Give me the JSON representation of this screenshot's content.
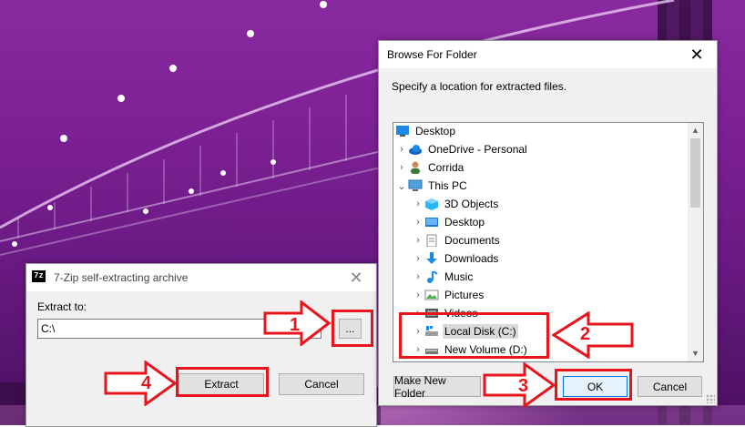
{
  "sfx_dialog": {
    "title": "7-Zip self-extracting archive",
    "app_icon_text": "7z",
    "close_glyph": "✕",
    "extract_to_label": "Extract to:",
    "extract_path_value": "C:\\",
    "browse_label": "...",
    "extract_label": "Extract",
    "cancel_label": "Cancel"
  },
  "browse_dialog": {
    "title": "Browse For Folder",
    "close_glyph": "✕",
    "instruction": "Specify a location for extracted files.",
    "tree": [
      {
        "label": "Desktop",
        "icon": "desktop-folder-icon",
        "chevron": ""
      },
      {
        "label": "OneDrive - Personal",
        "icon": "onedrive-cloud-icon",
        "chevron": "›"
      },
      {
        "label": "Corrida",
        "icon": "user-icon",
        "chevron": "›"
      },
      {
        "label": "This PC",
        "icon": "computer-icon",
        "chevron": "⌄"
      },
      {
        "label": "3D Objects",
        "icon": "3d-objects-icon",
        "chevron": "›"
      },
      {
        "label": "Desktop",
        "icon": "desktop-icon",
        "chevron": "›"
      },
      {
        "label": "Documents",
        "icon": "documents-icon",
        "chevron": "›"
      },
      {
        "label": "Downloads",
        "icon": "downloads-icon",
        "chevron": "›"
      },
      {
        "label": "Music",
        "icon": "music-icon",
        "chevron": "›"
      },
      {
        "label": "Pictures",
        "icon": "pictures-icon",
        "chevron": "›"
      },
      {
        "label": "Videos",
        "icon": "videos-icon",
        "chevron": "›"
      },
      {
        "label": "Local Disk (C:)",
        "icon": "local-disk-icon",
        "chevron": "›"
      },
      {
        "label": "New Volume (D:)",
        "icon": "drive-icon",
        "chevron": "›"
      }
    ],
    "new_folder_label": "Make New Folder",
    "ok_label": "OK",
    "cancel_label": "Cancel",
    "scroll_up_glyph": "▲",
    "scroll_down_glyph": "▼"
  },
  "annotations": {
    "step1": "1",
    "step2": "2",
    "step3": "3",
    "step4": "4",
    "color": "#e8141c"
  }
}
